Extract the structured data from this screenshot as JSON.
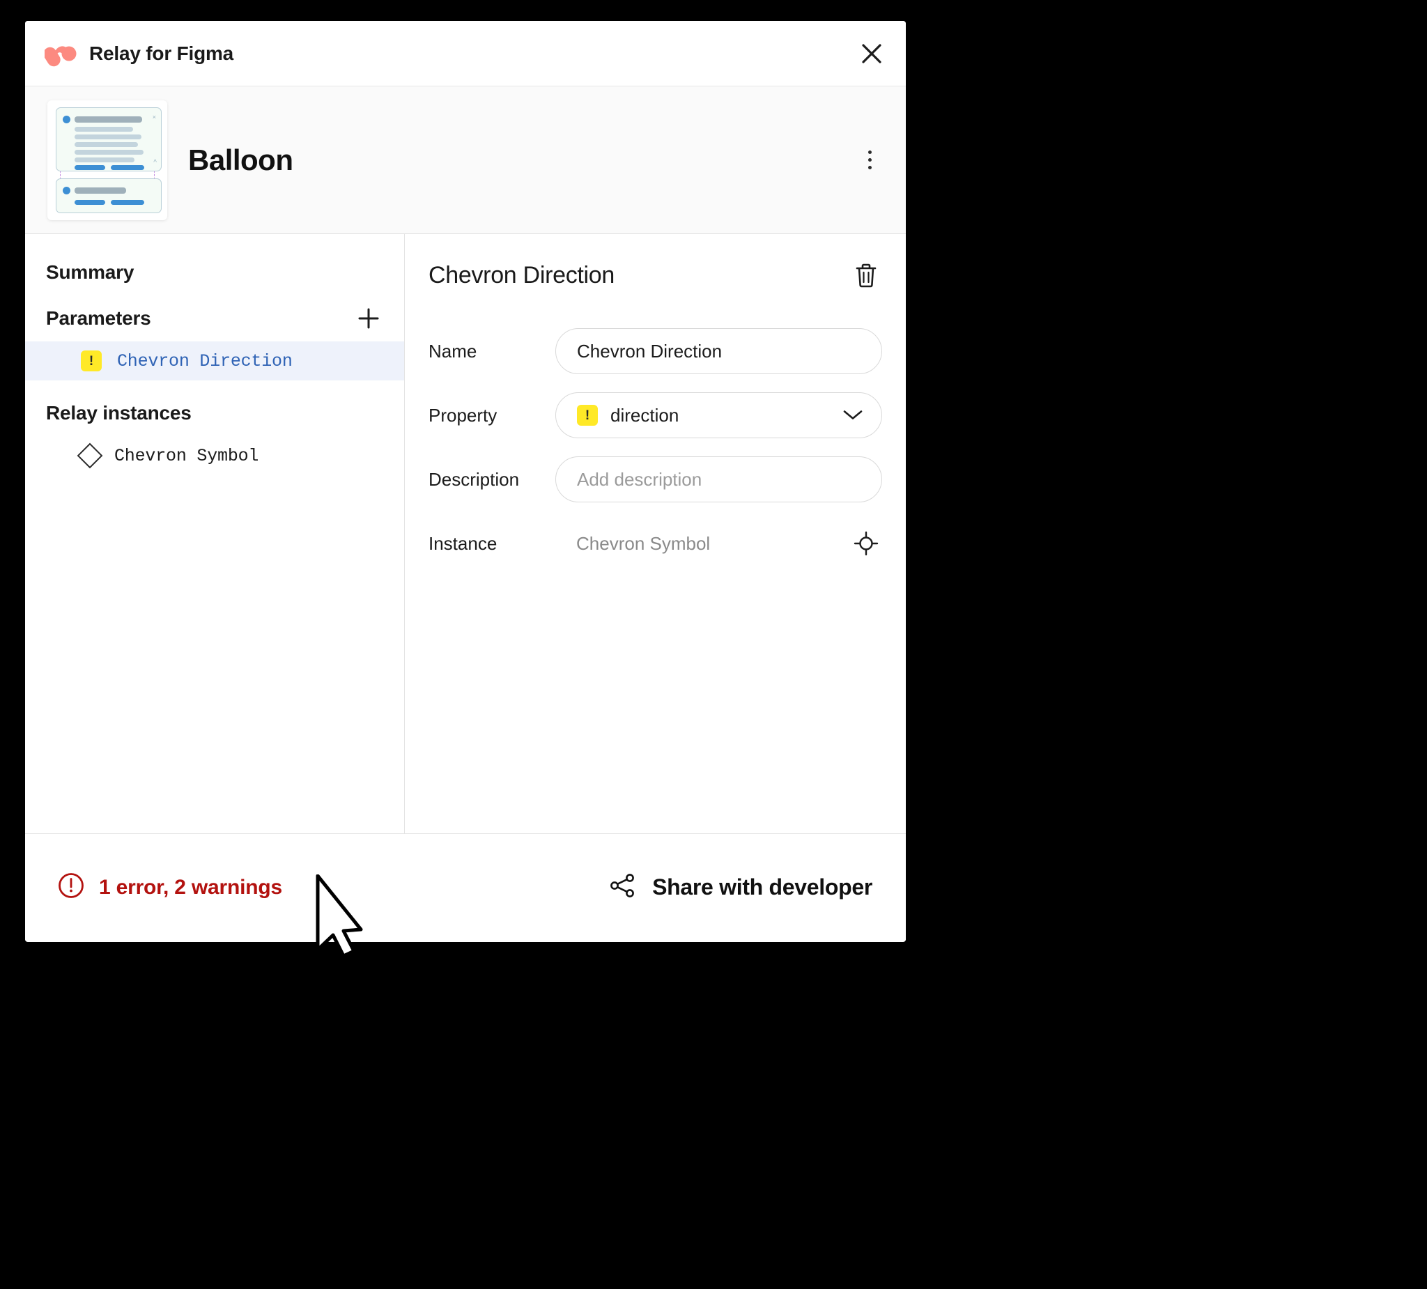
{
  "window": {
    "brand_title": "Relay for Figma",
    "close_icon": "close-icon",
    "logo_icon": "relay-logo-icon"
  },
  "component_header": {
    "name": "Balloon",
    "thumbnail_icon": "component-thumbnail",
    "overflow_icon": "kebab-menu-icon"
  },
  "left_pane": {
    "summary_label": "Summary",
    "parameters_label": "Parameters",
    "add_parameter_icon": "plus-icon",
    "parameters": [
      {
        "label": "Chevron Direction",
        "badge": "!",
        "badge_icon": "warning-badge-icon",
        "selected": true
      }
    ],
    "relay_instances_label": "Relay instances",
    "instances": [
      {
        "label": "Chevron Symbol",
        "icon": "diamond-component-icon"
      }
    ]
  },
  "detail_pane": {
    "title": "Chevron Direction",
    "delete_icon": "trash-icon",
    "name_label": "Name",
    "name_value": "Chevron Direction",
    "property_label": "Property",
    "property_value": "direction",
    "property_badge": "!",
    "property_dropdown_icon": "chevron-down-icon",
    "description_label": "Description",
    "description_value": "",
    "description_placeholder": "Add description",
    "instance_label": "Instance",
    "instance_value": "Chevron Symbol",
    "locate_icon": "target-locate-icon"
  },
  "footer": {
    "status_text": "1 error, 2 warnings",
    "status_icon": "error-circle-icon",
    "share_label": "Share with developer",
    "share_icon": "share-icon"
  },
  "colors": {
    "brand": "#fc8a80",
    "error": "#b3120f",
    "warning_badge": "#ffe927",
    "link": "#2f63b5",
    "selected_row": "#eef2fb"
  }
}
